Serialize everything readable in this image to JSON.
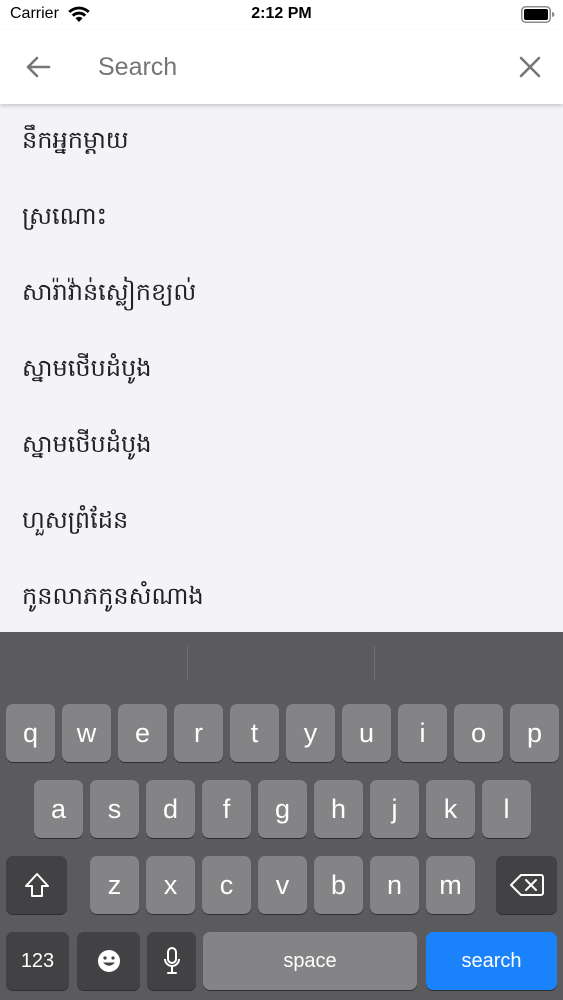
{
  "status_bar": {
    "carrier": "Carrier",
    "time": "2:12 PM"
  },
  "search": {
    "placeholder": "Search",
    "back_icon": "arrow-left-icon",
    "clear_icon": "close-icon"
  },
  "results": [
    {
      "label": "នឹកអ្នកម្ដាយ"
    },
    {
      "label": "ស្រណោះ"
    },
    {
      "label": "សារ៉ាវ៉ាន់ស្លៀកខ្យល់"
    },
    {
      "label": "ស្នាមថើបដំបូង"
    },
    {
      "label": "ស្នាមថើបដំបូង"
    },
    {
      "label": "ហួសព្រំដែន"
    },
    {
      "label": "កូនលាភកូនសំណាង"
    }
  ],
  "keyboard": {
    "row1": [
      "q",
      "w",
      "e",
      "r",
      "t",
      "y",
      "u",
      "i",
      "o",
      "p"
    ],
    "row2": [
      "a",
      "s",
      "d",
      "f",
      "g",
      "h",
      "j",
      "k",
      "l"
    ],
    "row3": [
      "z",
      "x",
      "c",
      "v",
      "b",
      "n",
      "m"
    ],
    "numbers_label": "123",
    "space_label": "space",
    "search_label": "search",
    "colors": {
      "background": "#5b5b5d",
      "key": "#848486",
      "function_key": "#424244",
      "search_key": "#1a82fb"
    }
  }
}
